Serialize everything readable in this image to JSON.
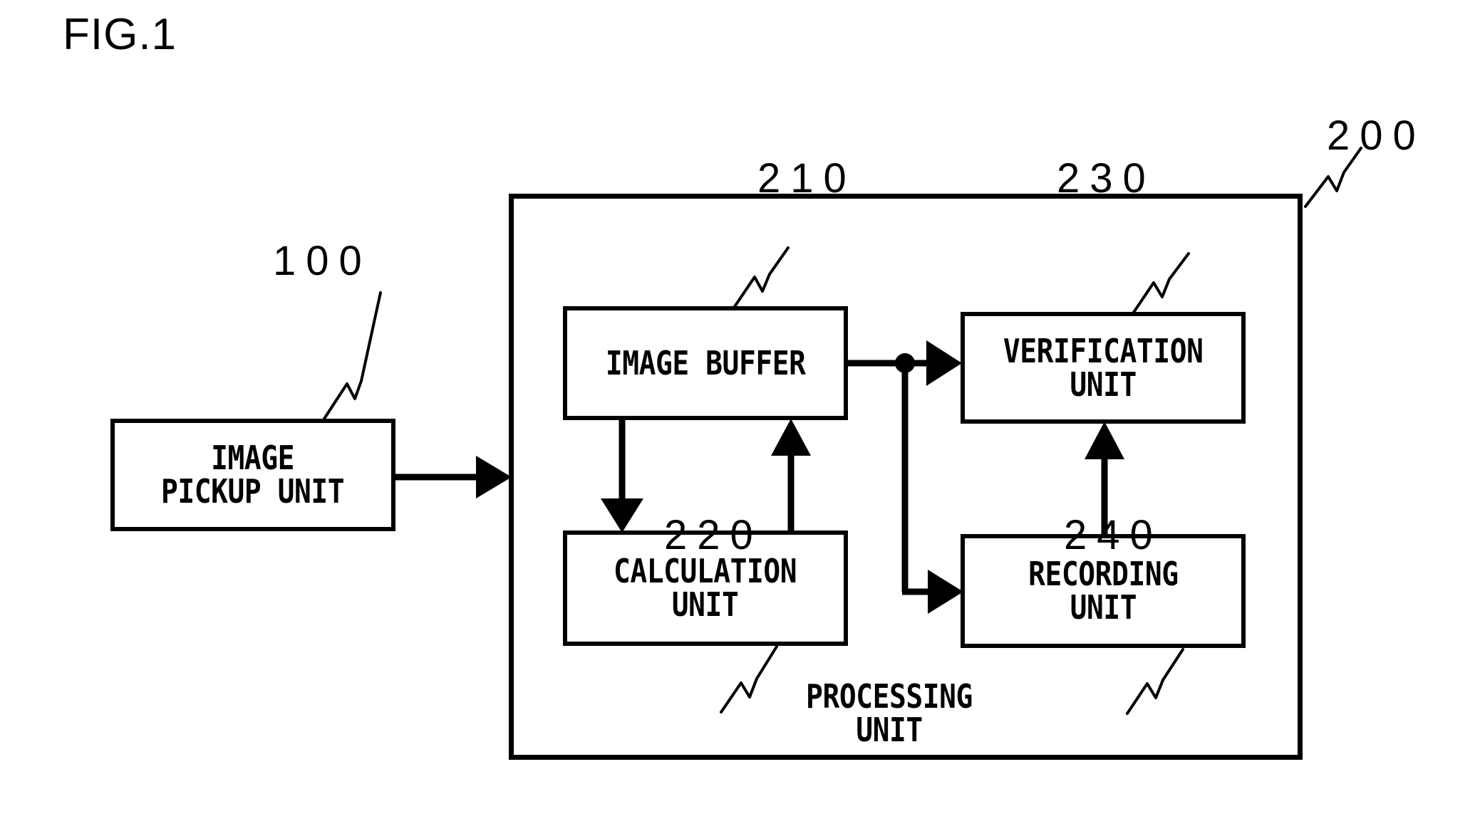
{
  "figure": {
    "title": "FIG.1"
  },
  "blocks": [
    {
      "id": "image-pickup",
      "label": "IMAGE\nPICKUP UNIT",
      "ref": "100"
    },
    {
      "id": "image-buffer",
      "label": "IMAGE BUFFER",
      "ref": "210"
    },
    {
      "id": "calculation",
      "label": "CALCULATION\nUNIT",
      "ref": "220"
    },
    {
      "id": "verification",
      "label": "VERIFICATION\nUNIT",
      "ref": "230"
    },
    {
      "id": "recording",
      "label": "RECORDING\nUNIT",
      "ref": "240"
    }
  ],
  "outer": {
    "label": "PROCESSING\nUNIT",
    "ref": "200"
  },
  "refs": {
    "r100": "100",
    "r200": "200",
    "r210": "210",
    "r220": "220",
    "r230": "230",
    "r240": "240"
  },
  "colors": {
    "ink": "#000000",
    "paper": "#ffffff"
  },
  "connections": [
    {
      "from": "image-pickup",
      "to": "processing-unit",
      "kind": "arrow-right"
    },
    {
      "from": "image-buffer",
      "to": "calculation",
      "kind": "arrow-down"
    },
    {
      "from": "calculation",
      "to": "image-buffer",
      "kind": "arrow-up"
    },
    {
      "from": "image-buffer",
      "to": "verification",
      "kind": "arrow-right-branch"
    },
    {
      "from": "image-buffer",
      "to": "recording",
      "kind": "arrow-right-branch"
    },
    {
      "from": "recording",
      "to": "verification",
      "kind": "arrow-up"
    }
  ]
}
